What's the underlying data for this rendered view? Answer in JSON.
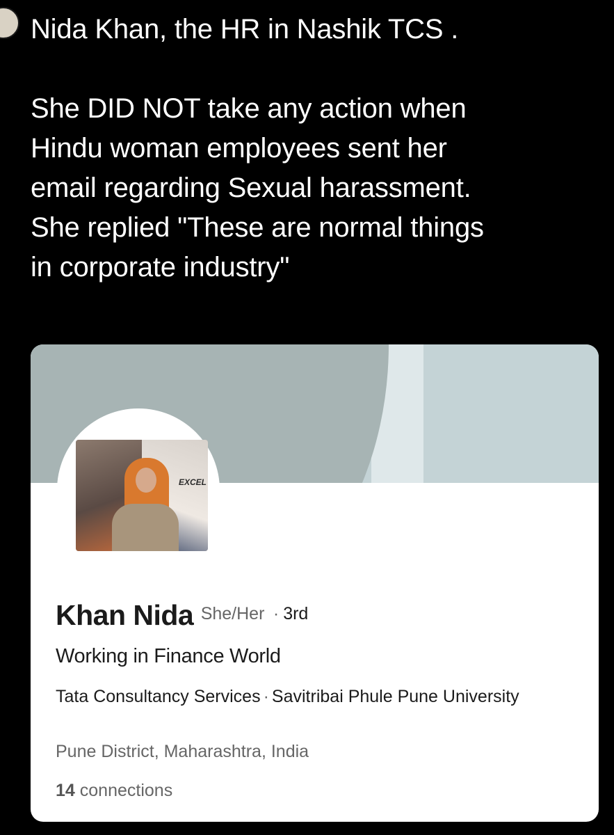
{
  "tweet": {
    "line1": "Nida Khan, the HR in Nashik TCS .",
    "body_line1": "She DID NOT take any action when",
    "body_line2": "Hindu woman employees sent her",
    "body_line3": "email regarding Sexual harassment.",
    "body_line4": "She replied \"These are normal things",
    "body_line5": "in corporate industry\""
  },
  "profile_card": {
    "photo_sign_text": "EXCEL",
    "name": "Khan Nida",
    "pronouns": "She/Her",
    "separator": "·",
    "degree": "3rd",
    "headline": "Working in Finance World",
    "company": "Tata Consultancy Services",
    "school": "Savitribai Phule Pune University",
    "location": "Pune District, Maharashtra, India",
    "connections_count": "14",
    "connections_label": "connections"
  },
  "colors": {
    "background": "#000000",
    "tweet_text": "#ffffff",
    "banner": "#c4d3d6",
    "banner_shape": "#a7b4b4",
    "card": "#ffffff",
    "secondary_text": "#666666"
  }
}
